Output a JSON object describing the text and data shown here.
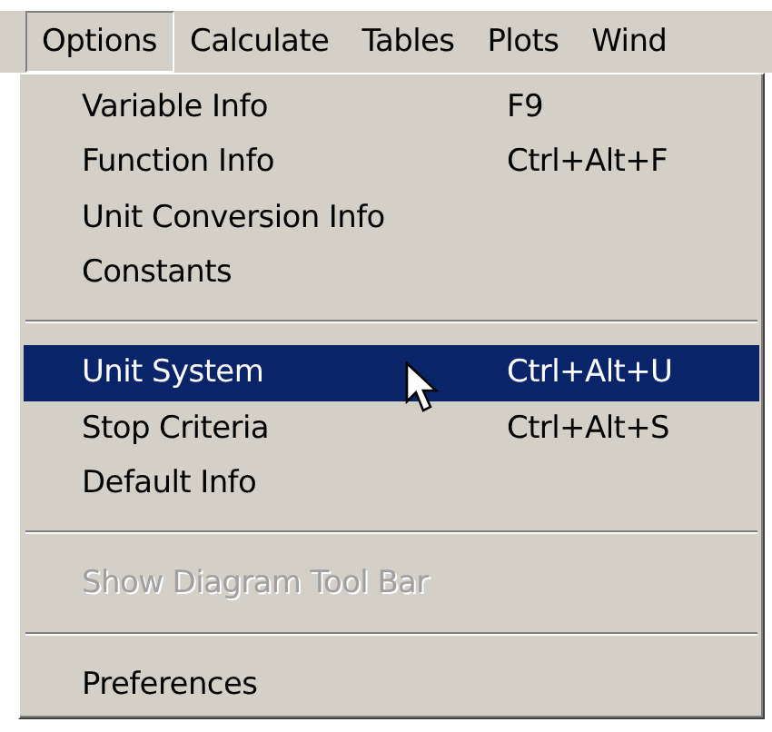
{
  "menubar": [
    {
      "label": "Options",
      "selected": true
    },
    {
      "label": "Calculate",
      "selected": false
    },
    {
      "label": "Tables",
      "selected": false
    },
    {
      "label": "Plots",
      "selected": false
    },
    {
      "label": "Wind",
      "selected": false
    }
  ],
  "menu": [
    {
      "kind": "item",
      "label": "Variable Info",
      "shortcut": "F9",
      "selected": false,
      "disabled": false
    },
    {
      "kind": "item",
      "label": "Function Info",
      "shortcut": "Ctrl+Alt+F",
      "selected": false,
      "disabled": false
    },
    {
      "kind": "item",
      "label": "Unit Conversion Info",
      "selected": false,
      "disabled": false
    },
    {
      "kind": "item",
      "label": "Constants",
      "selected": false,
      "disabled": false
    },
    {
      "kind": "separator"
    },
    {
      "kind": "item",
      "label": "Unit System",
      "shortcut": "Ctrl+Alt+U",
      "selected": true,
      "disabled": false
    },
    {
      "kind": "item",
      "label": "Stop Criteria",
      "shortcut": "Ctrl+Alt+S",
      "selected": false,
      "disabled": false
    },
    {
      "kind": "item",
      "label": "Default Info",
      "selected": false,
      "disabled": false
    },
    {
      "kind": "separator"
    },
    {
      "kind": "item",
      "label": "Show Diagram Tool Bar",
      "selected": false,
      "disabled": true
    },
    {
      "kind": "separator"
    },
    {
      "kind": "item",
      "label": "Preferences",
      "selected": false,
      "disabled": false
    }
  ]
}
